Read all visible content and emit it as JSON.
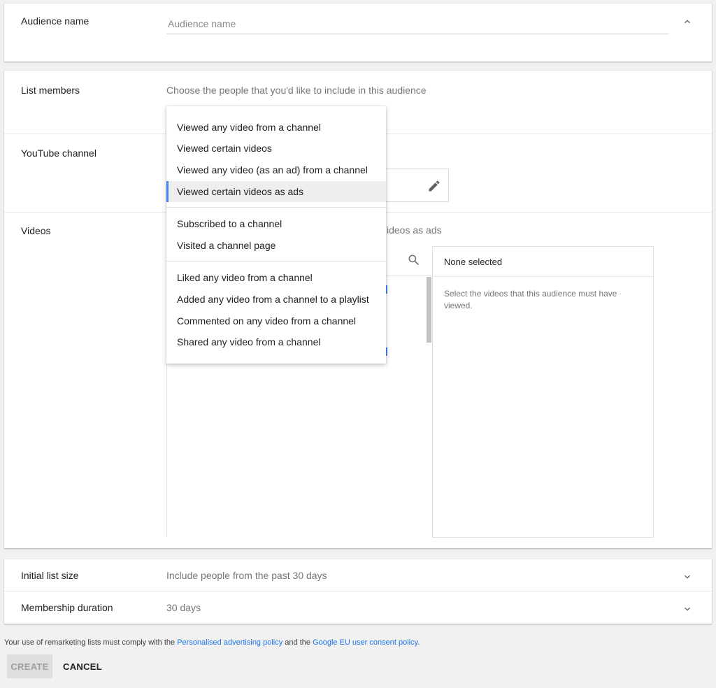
{
  "audience_name": {
    "label": "Audience name",
    "placeholder": "Audience name"
  },
  "list_members": {
    "label": "List members",
    "placeholder": "Choose the people that you'd like to include in this audience",
    "menu": {
      "group1": [
        "Viewed any video from a channel",
        "Viewed certain videos",
        "Viewed any video (as an ad) from a channel",
        "Viewed certain videos as ads"
      ],
      "group2": [
        "Subscribed to a channel",
        "Visited a channel page"
      ],
      "group3": [
        "Liked any video from a channel",
        "Added any video from a channel to a playlist",
        "Commented on any video from a channel",
        "Shared any video from a channel"
      ],
      "selected": "Viewed certain videos as ads"
    }
  },
  "youtube_channel": {
    "label": "YouTube channel"
  },
  "videos": {
    "label": "Videos",
    "subtitle_visible": "ideos as ads",
    "selected_header": "None selected",
    "selected_hint": "Select the videos that this audience must have viewed."
  },
  "initial_list_size": {
    "label": "Initial list size",
    "value": "Include people from the past 30 days"
  },
  "membership_duration": {
    "label": "Membership duration",
    "value": "30 days"
  },
  "footer": {
    "text_before": "Your use of remarketing lists must comply with the ",
    "link1": "Personalised advertising policy",
    "text_middle": " and the ",
    "link2": "Google EU user consent policy",
    "text_after": "."
  },
  "actions": {
    "create": "CREATE",
    "cancel": "CANCEL"
  },
  "colors": {
    "accent": "#4285f4",
    "link": "#1a73e8",
    "background": "#f1f1f1"
  }
}
